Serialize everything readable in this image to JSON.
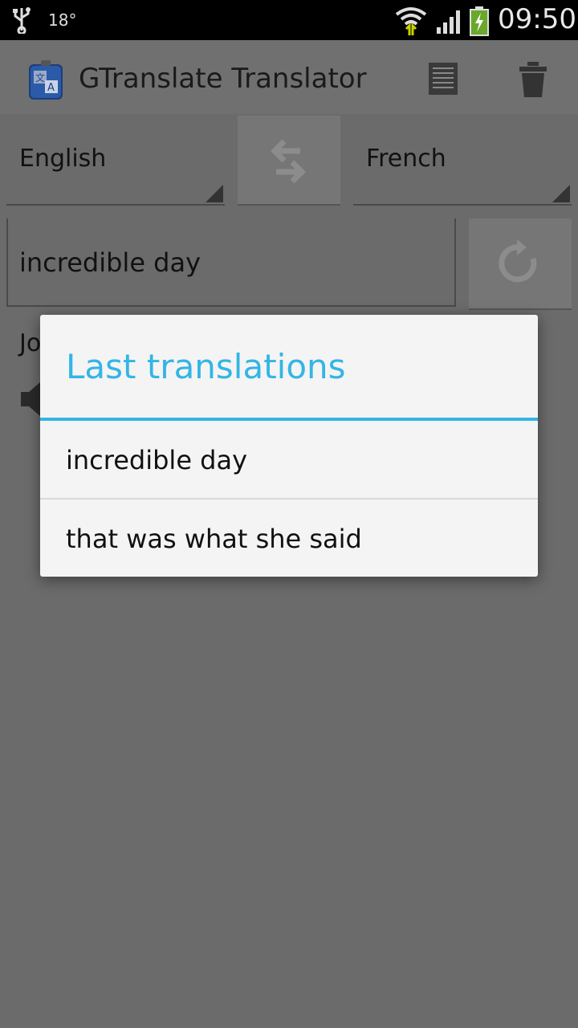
{
  "status_bar": {
    "temperature": "18°",
    "time": "09:50"
  },
  "app": {
    "title": "GTranslate Translator"
  },
  "languages": {
    "source": "English",
    "target": "French"
  },
  "input": {
    "value": "incredible day"
  },
  "result": {
    "text": "Jo"
  },
  "dialog": {
    "title": "Last translations",
    "items": [
      {
        "label": "incredible day"
      },
      {
        "label": "that was what she said"
      }
    ]
  },
  "colors": {
    "accent": "#33b5e5",
    "scrim": "#6b6b6b"
  }
}
